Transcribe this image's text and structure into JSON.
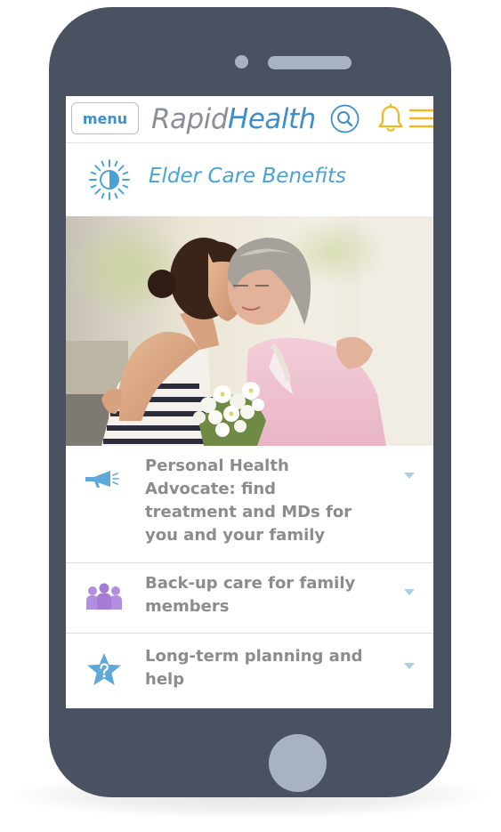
{
  "header": {
    "menu_label": "menu",
    "brand_part1": "Rapid",
    "brand_part2": "Health"
  },
  "section": {
    "title": "Elder Care Benefits",
    "icon": "sun-icon"
  },
  "hero": {
    "image": "photo of a younger woman hugging an older woman holding flowers"
  },
  "items": [
    {
      "label": "Personal Health Advocate: find treatment and MDs for you and your family",
      "icon": "megaphone-icon"
    },
    {
      "label": "Back-up care for family members",
      "icon": "family-group-icon"
    },
    {
      "label": "Long-term planning and help",
      "icon": "star-question-icon"
    }
  ],
  "colors": {
    "phone_body": "#4a5261",
    "phone_detail": "#a9b2c2",
    "brand_blue": "#3e8fc9",
    "brand_gray": "#8a8e96",
    "accent_yellow": "#f2b824",
    "title_blue": "#4aa3d4",
    "item_text": "#8c8c8c",
    "group_icon_purple": "#b38de0"
  }
}
